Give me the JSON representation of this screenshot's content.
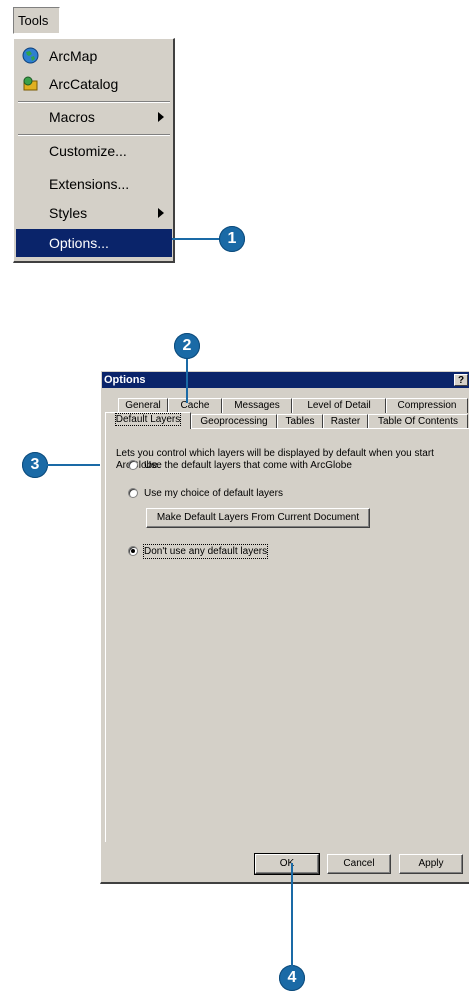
{
  "menu": {
    "title": "Tools",
    "items": [
      {
        "label": "ArcMap",
        "icon": "arcmap-globe-icon"
      },
      {
        "label": "ArcCatalog",
        "icon": "arccatalog-icon"
      },
      {
        "label": "Macros",
        "submenu": true
      },
      {
        "label": "Customize..."
      },
      {
        "label": "Extensions..."
      },
      {
        "label": "Styles",
        "submenu": true
      },
      {
        "label": "Options...",
        "selected": true
      }
    ]
  },
  "callouts": [
    "1",
    "2",
    "3",
    "4"
  ],
  "dialog": {
    "title": "Options",
    "help": "?",
    "tabs_row1": [
      "General",
      "Cache",
      "Messages",
      "Level of Detail",
      "Compression"
    ],
    "tabs_row2": [
      "Default Layers",
      "Geoprocessing",
      "Tables",
      "Raster",
      "Table Of Contents"
    ],
    "description": "Lets you control which layers will be displayed by default when you start ArcGlobe.",
    "options": [
      {
        "label": "Use the default layers that come with ArcGlobe",
        "checked": false
      },
      {
        "label": "Use my choice of default layers",
        "checked": false
      },
      {
        "label": "Don't use any default layers",
        "checked": true
      }
    ],
    "make_default_button": "Make Default Layers From Current Document",
    "ok": "OK",
    "cancel": "Cancel",
    "apply": "Apply"
  },
  "colors": {
    "selection": "#0a246a",
    "callout": "#1a6aa6",
    "face": "#d4d0c8"
  }
}
